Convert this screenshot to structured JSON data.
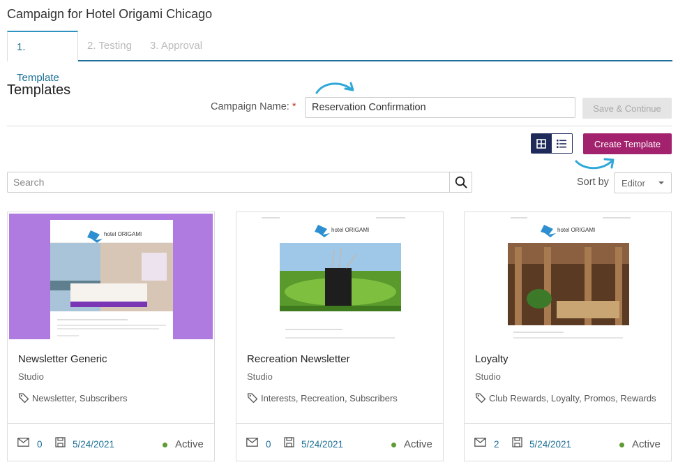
{
  "page": {
    "title": "Campaign for Hotel Origami Chicago"
  },
  "tabs": [
    {
      "label": "1. Template",
      "active": true
    },
    {
      "label": "2. Testing",
      "active": false
    },
    {
      "label": "3. Approval",
      "active": false
    }
  ],
  "section": {
    "title": "Templates"
  },
  "campaign": {
    "label": "Campaign Name:",
    "required_mark": "*",
    "value": "Reservation Confirmation"
  },
  "actions": {
    "save_label": "Save & Continue",
    "create_label": "Create Template"
  },
  "view_toggle": {
    "grid_icon": "grid-view-icon",
    "list_icon": "list-view-icon",
    "selected": "grid"
  },
  "search": {
    "placeholder": "Search",
    "icon": "search-icon"
  },
  "sort": {
    "label": "Sort by",
    "selected": "Editor"
  },
  "colors": {
    "accent": "#1b6f96",
    "create": "#a3226d",
    "toggle_dark": "#1e2a5a",
    "status_active": "#5e9b35",
    "arrow": "#2fa8d8"
  },
  "cards": [
    {
      "name": "Newsletter Generic",
      "editor": "Studio",
      "tags": "Newsletter, Subscribers",
      "sends": "0",
      "date": "5/24/2021",
      "status": "Active",
      "thumb_bg": "#b07be0",
      "brand": "hotel ORIGAMI"
    },
    {
      "name": "Recreation Newsletter",
      "editor": "Studio",
      "tags": "Interests, Recreation, Subscribers",
      "sends": "0",
      "date": "5/24/2021",
      "status": "Active",
      "thumb_bg": "#ffffff",
      "brand": "hotel ORIGAMI"
    },
    {
      "name": "Loyalty",
      "editor": "Studio",
      "tags": "Club Rewards, Loyalty, Promos, Rewards",
      "sends": "2",
      "date": "5/24/2021",
      "status": "Active",
      "thumb_bg": "#ffffff",
      "brand": "hotel ORIGAMI"
    }
  ]
}
